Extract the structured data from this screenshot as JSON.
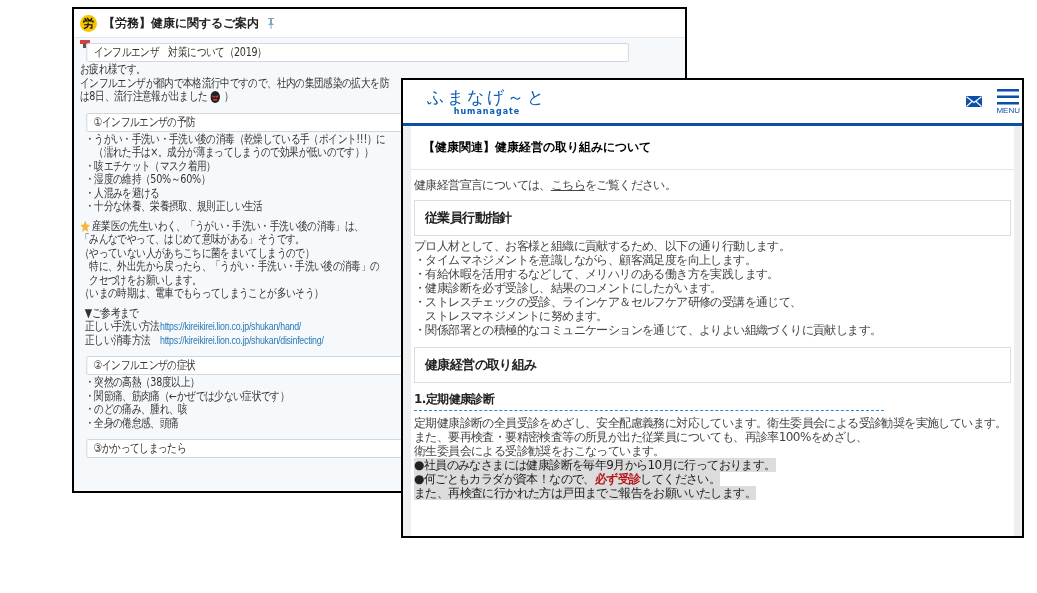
{
  "back_window": {
    "badge": "労",
    "title": "【労務】健康に関するご案内",
    "blocks": [
      {
        "kind": "heading",
        "text": "インフルエンザ　対策について（2019）"
      },
      {
        "kind": "line",
        "text": "お疲れ様です。"
      },
      {
        "kind": "line",
        "text": "インフルエンザが都内で本格流行中ですので、社内の集団感染の拡大を防"
      },
      {
        "kind": "icon_line",
        "before": "は8日、流行注意報が出ました",
        "after": "）"
      },
      {
        "kind": "gap"
      },
      {
        "kind": "heading",
        "text": "①インフルエンザの予防"
      },
      {
        "kind": "bullet",
        "text": "・うがい・手洗い・手洗い後の消毒（乾燥している手（ポイント!!!）に"
      },
      {
        "kind": "bullet",
        "text": "　（濡れた手は×。成分が薄まってしまうので効果が低いのです））"
      },
      {
        "kind": "bullet",
        "text": "・咳エチケット（マスク着用）"
      },
      {
        "kind": "bullet",
        "text": "・湿度の維持（50%～60%）"
      },
      {
        "kind": "bullet",
        "text": "・人混みを避ける"
      },
      {
        "kind": "bullet",
        "text": "・十分な休養、栄養摂取、規則正しい生活"
      },
      {
        "kind": "gap"
      },
      {
        "kind": "star_line",
        "text": "産業医の先生いわく、「うがい・手洗い・手洗い後の消毒」は、"
      },
      {
        "kind": "line",
        "text": "「みんなでやって、はじめて意味がある」そうです。"
      },
      {
        "kind": "line",
        "text": "（やっていない人があちこちに菌をまいてしまうので）"
      },
      {
        "kind": "line",
        "text": "　特に、外出先から戻ったら、「うがい・手洗い・手洗い後の消毒」の"
      },
      {
        "kind": "line",
        "text": "　クセづけをお願いします。"
      },
      {
        "kind": "line",
        "text": "（いまの時期は、電車でもらってしまうことが多いそう）"
      },
      {
        "kind": "gap"
      },
      {
        "kind": "bullet",
        "text": "▼ご参考まで"
      },
      {
        "kind": "link",
        "label": "正しい手洗い方法",
        "url": "https://kireikirei.lion.co.jp/shukan/hand/"
      },
      {
        "kind": "link",
        "label": "正しい消毒方法",
        "url": "https://kireikirei.lion.co.jp/shukan/disinfecting/"
      },
      {
        "kind": "gap"
      },
      {
        "kind": "heading",
        "text": "②インフルエンザの症状"
      },
      {
        "kind": "bullet",
        "text": "・突然の高熱（38度以上）"
      },
      {
        "kind": "bullet",
        "text": "・関節痛、筋肉痛（←かぜでは少ない症状です）"
      },
      {
        "kind": "bullet",
        "text": "・のどの痛み、腫れ、咳"
      },
      {
        "kind": "bullet",
        "text": "・全身の倦怠感、頭痛"
      },
      {
        "kind": "gap"
      },
      {
        "kind": "heading",
        "text": "③かかってしまったら"
      }
    ]
  },
  "front_window": {
    "logo": "ふまなげ～と",
    "logo_sub": "humanagate",
    "menu_label": "MENU",
    "page_title": "【健康関連】健康経営の取り組みについて",
    "intro": {
      "before": "健康経営宣言については、",
      "link": "こちら",
      "after": "をご覧ください。"
    },
    "blocks": [
      {
        "kind": "box",
        "text": "従業員行動指針"
      },
      {
        "kind": "line",
        "parts": [
          {
            "text": "プロ人材として、お客様と組織に貢献するため、以下の通り行動します。"
          }
        ]
      },
      {
        "kind": "line",
        "parts": [
          {
            "text": "・タイムマネジメントを意識しながら、顧客満足度を向上します。"
          }
        ]
      },
      {
        "kind": "line",
        "parts": [
          {
            "text": "・有給休暇を活用するなどして、メリハリのある働き方を実践します。"
          }
        ]
      },
      {
        "kind": "line",
        "parts": [
          {
            "text": "・健康診断を必ず受診し、結果のコメントにしたがいます。"
          }
        ]
      },
      {
        "kind": "line",
        "parts": [
          {
            "text": "・ストレスチェックの受診、ラインケア＆セルフケア研修の受講を通じて、"
          }
        ]
      },
      {
        "kind": "line",
        "parts": [
          {
            "text": "　ストレスマネジメントに努めます。"
          }
        ]
      },
      {
        "kind": "line",
        "parts": [
          {
            "text": "・関係部署との積極的なコミュニケーションを通じて、よりよい組織づくりに貢献します。"
          }
        ]
      },
      {
        "kind": "box",
        "text": "健康経営の取り組み"
      },
      {
        "kind": "subheading",
        "text": "1.定期健康診断"
      },
      {
        "kind": "line",
        "parts": [
          {
            "text": "定期健康診断の全員受診をめざし、安全配慮義務に対応しています。衛生委員会による受診勧奨を実施しています。"
          }
        ]
      },
      {
        "kind": "line",
        "parts": [
          {
            "text": "また、要再検査・要精密検査等の所見が出た従業員についても、再診率100%をめざし、"
          }
        ]
      },
      {
        "kind": "line",
        "parts": [
          {
            "text": "衛生委員会による受診勧奨をおこなっています。"
          }
        ]
      },
      {
        "kind": "highlight",
        "parts": [
          {
            "text": "●社員のみなさまには健康診断を毎年9月から10月に行っております。"
          }
        ]
      },
      {
        "kind": "highlight",
        "parts": [
          {
            "text": "●何ごともカラダが資本！なので、"
          },
          {
            "text": "必ず受診",
            "emphasis": true
          },
          {
            "text": "してください。"
          }
        ]
      },
      {
        "kind": "highlight",
        "parts": [
          {
            "text": "また、再検査に行かれた方は戸田までご報告をお願いいたします。"
          }
        ]
      }
    ]
  }
}
